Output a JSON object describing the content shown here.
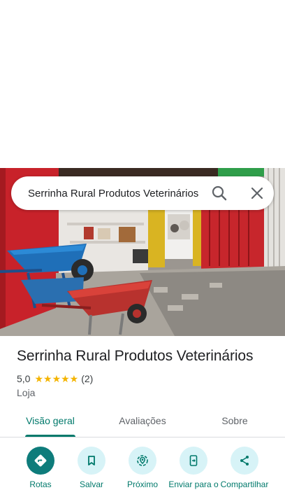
{
  "search": {
    "query": "Serrinha Rural Produtos Veterinários"
  },
  "place": {
    "title": "Serrinha Rural Produtos Veterinários",
    "rating": "5,0",
    "stars": "★★★★★",
    "review_count": "(2)",
    "category": "Loja"
  },
  "tabs": [
    {
      "label": "Visão geral",
      "active": true
    },
    {
      "label": "Avaliações",
      "active": false
    },
    {
      "label": "Sobre",
      "active": false
    }
  ],
  "actions": [
    {
      "label": "Rotas",
      "icon": "directions-icon"
    },
    {
      "label": "Salvar",
      "icon": "bookmark-icon"
    },
    {
      "label": "Próximo",
      "icon": "nearby-icon"
    },
    {
      "label": "Enviar para o",
      "icon": "send-to-phone-icon"
    },
    {
      "label": "Compartilhar",
      "icon": "share-icon"
    }
  ],
  "colors": {
    "accent": "#00796b",
    "action_bg": "#d7f3f7",
    "primary_action": "#0e7c7b",
    "star": "#f4b400"
  }
}
